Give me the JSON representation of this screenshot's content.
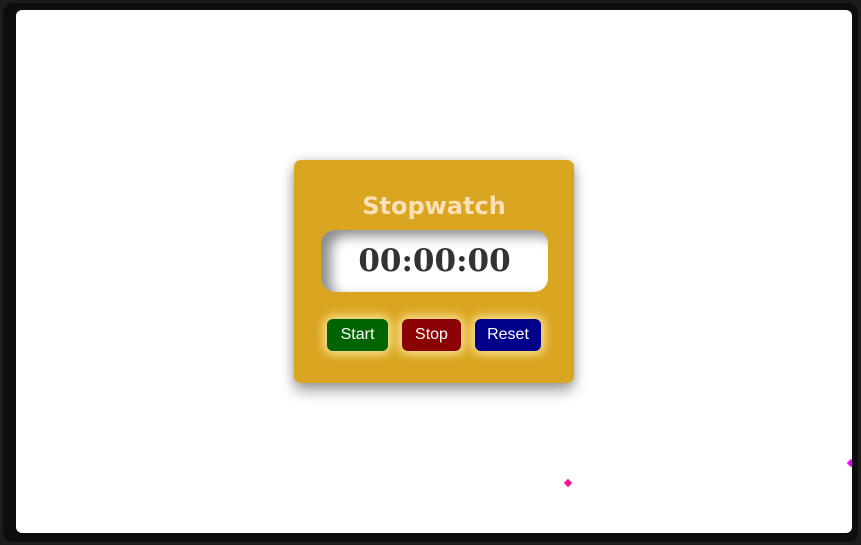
{
  "stopwatch": {
    "title": "Stopwatch",
    "time": "00:00:00",
    "buttons": {
      "start": "Start",
      "stop": "Stop",
      "reset": "Reset"
    }
  },
  "colors": {
    "card": "#daa520",
    "title": "#ffe0b8",
    "start": "#006400",
    "stop": "#8b0000",
    "reset": "#00008b",
    "sparkle": "#ff00ff"
  }
}
